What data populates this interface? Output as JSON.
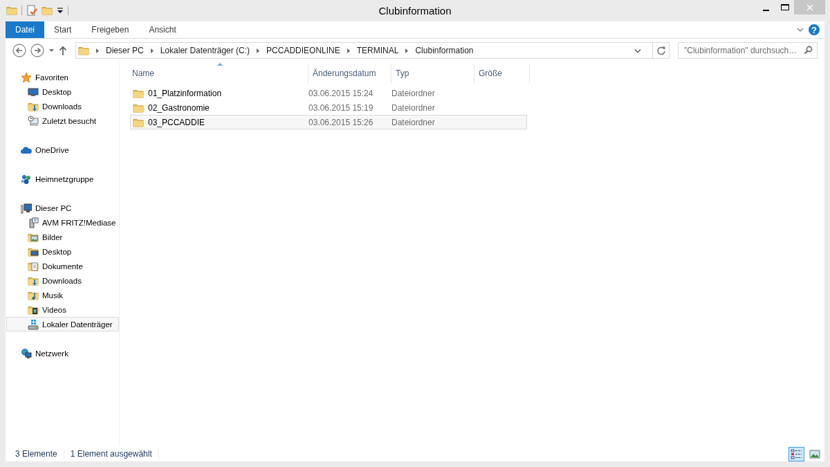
{
  "window": {
    "title": "Clubinformation"
  },
  "ribbon": {
    "tabs": [
      {
        "label": "Datei",
        "kind": "file"
      },
      {
        "label": "Start",
        "kind": "tab"
      },
      {
        "label": "Freigeben",
        "kind": "tab"
      },
      {
        "label": "Ansicht",
        "kind": "tab"
      }
    ],
    "help": "?"
  },
  "address_bar": {
    "crumbs": [
      "Dieser PC",
      "Lokaler Datenträger (C:)",
      "PCCADDIEONLINE",
      "TERMINAL",
      "Clubinformation"
    ]
  },
  "search": {
    "placeholder": "\"Clubinformation\" durchsuch…"
  },
  "sidebar": {
    "groups": [
      {
        "label": "Favoriten",
        "kind": "star",
        "selected": false,
        "children": [
          {
            "label": "Desktop",
            "kind": "desktop",
            "selected": false
          },
          {
            "label": "Downloads",
            "kind": "downloads",
            "selected": false
          },
          {
            "label": "Zuletzt besucht",
            "kind": "recent",
            "selected": false
          }
        ]
      },
      {
        "label": "OneDrive",
        "kind": "cloud",
        "selected": false
      },
      {
        "label": "Heimnetzgruppe",
        "kind": "homegroup",
        "selected": false
      },
      {
        "label": "Dieser PC",
        "kind": "pc",
        "selected": false,
        "children": [
          {
            "label": "AVM FRITZ!Mediase",
            "kind": "media",
            "selected": false
          },
          {
            "label": "Bilder",
            "kind": "pictures",
            "selected": false
          },
          {
            "label": "Desktop",
            "kind": "desktopfolder",
            "selected": false
          },
          {
            "label": "Dokumente",
            "kind": "documents",
            "selected": false
          },
          {
            "label": "Downloads",
            "kind": "downloads",
            "selected": false
          },
          {
            "label": "Musik",
            "kind": "music",
            "selected": false
          },
          {
            "label": "Videos",
            "kind": "videos",
            "selected": false
          },
          {
            "label": "Lokaler Datenträger",
            "kind": "drive",
            "selected": true
          }
        ]
      },
      {
        "label": "Netzwerk",
        "kind": "network",
        "selected": false
      }
    ]
  },
  "table": {
    "columns": [
      {
        "label": "Name",
        "sorted": true
      },
      {
        "label": "Änderungsdatum",
        "sorted": false
      },
      {
        "label": "Typ",
        "sorted": false
      },
      {
        "label": "Größe",
        "sorted": false
      }
    ],
    "rows": [
      {
        "name": "01_Platzinformation",
        "date": "03.06.2015 15:24",
        "type": "Dateiordner",
        "selected": false
      },
      {
        "name": "02_Gastronomie",
        "date": "03.06.2015 15:19",
        "type": "Dateiordner",
        "selected": false
      },
      {
        "name": "03_PCCADDIE",
        "date": "03.06.2015 15:26",
        "type": "Dateiordner",
        "selected": true
      }
    ]
  },
  "status_bar": {
    "item_count": "3 Elemente",
    "selection": "1 Element ausgewählt",
    "views": [
      {
        "kind": "details",
        "selected": true
      },
      {
        "kind": "tiles",
        "selected": false
      }
    ]
  }
}
